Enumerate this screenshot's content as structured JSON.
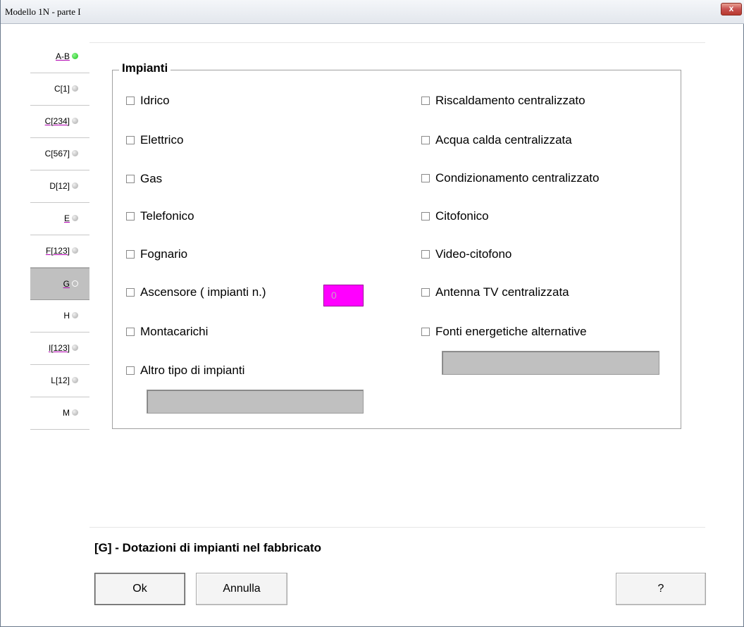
{
  "window": {
    "title": "Modello 1N  -   parte I",
    "close_label": "x"
  },
  "tabs": [
    {
      "label": "A-B",
      "status": "green"
    },
    {
      "label": "C[1]",
      "status": "gray"
    },
    {
      "label": "C[234]",
      "status": "gray"
    },
    {
      "label": "C[567]",
      "status": "gray"
    },
    {
      "label": "D[12]",
      "status": "gray"
    },
    {
      "label": "E",
      "status": "gray"
    },
    {
      "label": "F[123]",
      "status": "gray"
    },
    {
      "label": "G",
      "status": "selected"
    },
    {
      "label": "H",
      "status": "gray"
    },
    {
      "label": "I[123]",
      "status": "gray"
    },
    {
      "label": "L[12]",
      "status": "gray"
    },
    {
      "label": "M",
      "status": "gray"
    }
  ],
  "group": {
    "title": "Impianti",
    "left": [
      {
        "label": "Idrico",
        "checked": false
      },
      {
        "label": "Elettrico",
        "checked": false
      },
      {
        "label": "Gas",
        "checked": false
      },
      {
        "label": "Telefonico",
        "checked": false
      },
      {
        "label": "Fognario",
        "checked": false
      },
      {
        "label": "Ascensore ( impianti n.)",
        "checked": false
      },
      {
        "label": "Montacarichi",
        "checked": false
      },
      {
        "label": "Altro tipo di impianti",
        "checked": false
      }
    ],
    "right": [
      {
        "label": "Riscaldamento centralizzato",
        "checked": false
      },
      {
        "label": "Acqua calda centralizzata",
        "checked": false
      },
      {
        "label": "Condizionamento centralizzato",
        "checked": false
      },
      {
        "label": "Citofonico",
        "checked": false
      },
      {
        "label": "Video-citofono",
        "checked": false
      },
      {
        "label": "Antenna TV centralizzata",
        "checked": false
      },
      {
        "label": "Fonti energetiche alternative",
        "checked": false
      }
    ],
    "ascensore_count": "0",
    "altro_value": "",
    "fonti_value": ""
  },
  "section_caption": "[G] - Dotazioni di impianti nel fabbricato",
  "buttons": {
    "ok": "Ok",
    "annulla": "Annulla",
    "help": "?"
  },
  "colors": {
    "accent_magenta": "#ff00ff",
    "status_green": "#18c418",
    "selected_tab": "#c0c0c0"
  }
}
